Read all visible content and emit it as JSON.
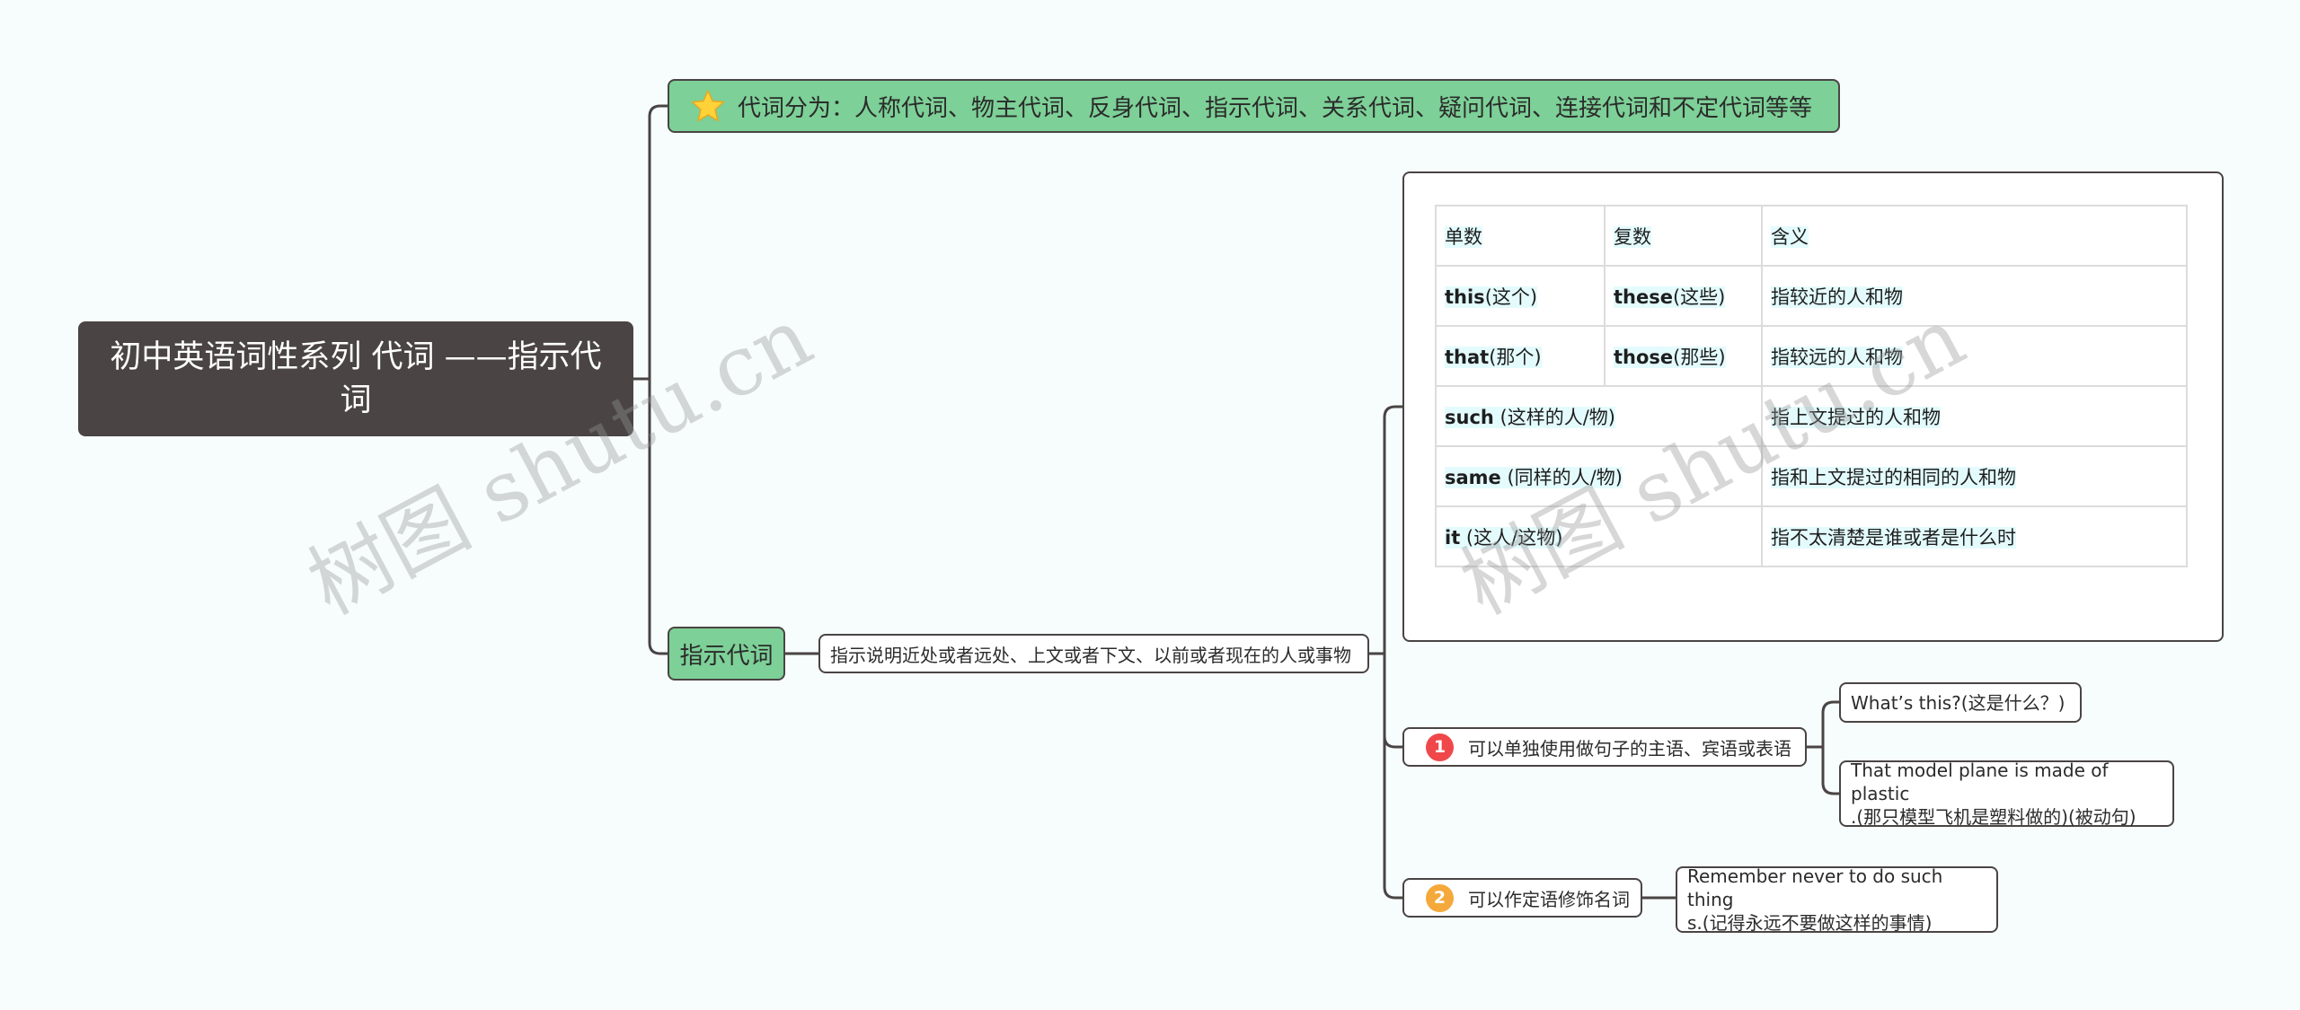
{
  "root": {
    "title": "初中英语词性系列 代词 ——指示代词"
  },
  "topics": {
    "classification": {
      "icon": "star-icon",
      "text": "代词分为：人称代词、物主代词、反身代词、指示代词、关系代词、疑问代词、连接代词和不定代词等等"
    },
    "demonstrative": {
      "label": "指示代词"
    }
  },
  "description": "指示说明近处或者远处、上文或者下文、以前或者现在的人或事物",
  "table": {
    "headers": [
      "单数",
      "复数",
      "含义"
    ],
    "rows": [
      {
        "singular_word": "this",
        "singular_note": "(这个)",
        "plural_word": "these",
        "plural_note": "(这些)",
        "meaning": "指较近的人和物"
      },
      {
        "singular_word": "that",
        "singular_note": "(那个)",
        "plural_word": "those",
        "plural_note": "(那些)",
        "meaning": "指较远的人和物"
      },
      {
        "word": "such",
        "note": " (这样的人/物)",
        "meaning": "指上文提过的人和物"
      },
      {
        "word": "same",
        "note": " (同样的人/物)",
        "meaning": "指和上文提过的相同的人和物"
      },
      {
        "word": "it",
        "note": " (这人/这物)",
        "meaning": "指不太清楚是谁或者是什么时"
      }
    ]
  },
  "features": [
    {
      "badge": "1",
      "badge_color": "#f0484a",
      "text": "可以单独使用做句子的主语、宾语或表语",
      "examples": [
        {
          "line1": "What’s this?(这是什么？)"
        },
        {
          "line1": "That model plane is made of plastic",
          "line2": ".(那只模型飞机是塑料做的)(被动句)"
        }
      ]
    },
    {
      "badge": "2",
      "badge_color": "#f4a93a",
      "text": "可以作定语修饰名词",
      "examples": [
        {
          "line1": "Remember never to do such thing",
          "line2": "s.(记得永远不要做这样的事情)"
        }
      ]
    }
  ],
  "watermark": "树图 shutu.cn",
  "colors": {
    "root_bg": "#4a4444",
    "topic_bg": "#7dd097",
    "line": "#4a4444",
    "background": "#f7fdfd"
  }
}
